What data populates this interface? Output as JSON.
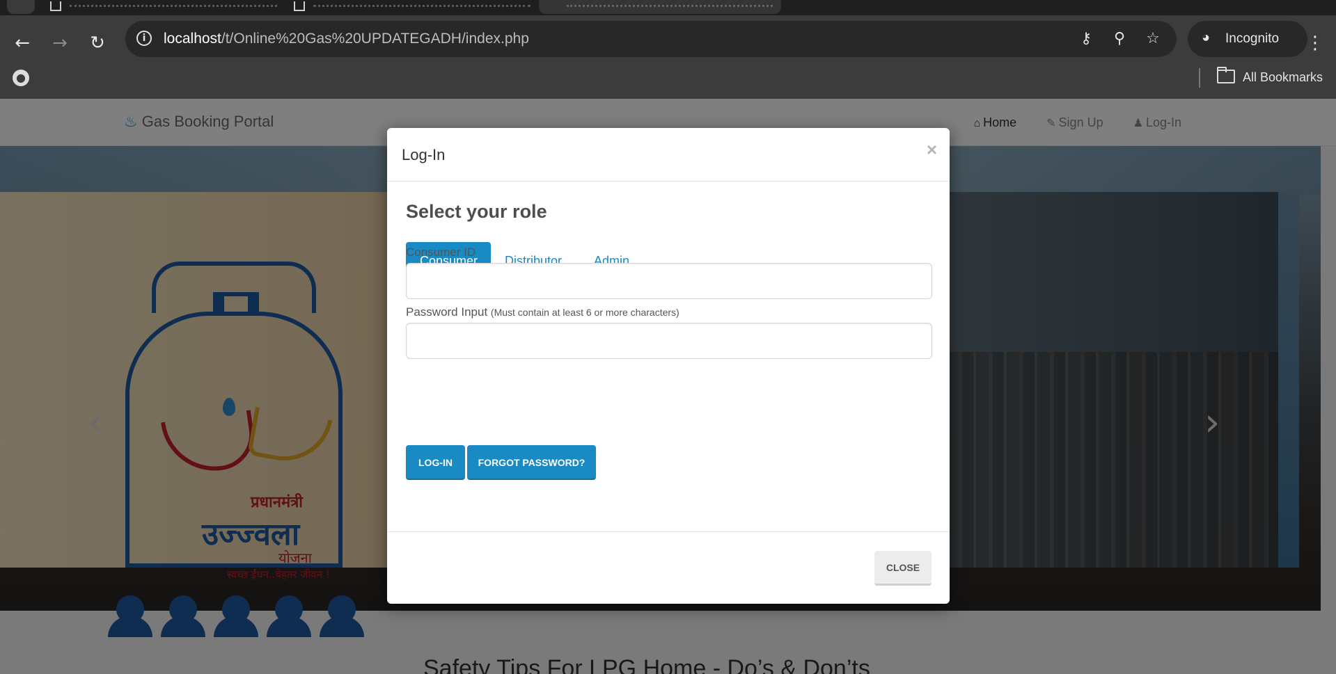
{
  "browser": {
    "url_host": "localhost",
    "url_path": "/t/Online%20Gas%20UPDATEGADH/index.php",
    "incognito_label": "Incognito",
    "bookmarks_label": "All Bookmarks"
  },
  "navbar": {
    "brand": "Gas Booking Portal",
    "links": [
      {
        "label": "Home",
        "icon": "home-icon"
      },
      {
        "label": "Sign Up",
        "icon": "pencil-icon"
      },
      {
        "label": "Log-In",
        "icon": "user-icon"
      }
    ]
  },
  "hero": {
    "logo_line1": "प्रधानमंत्री",
    "logo_line2": "उज्ज्वला",
    "logo_line3": "योजना",
    "logo_line4": "स्वच्छ ईंधन..बेहतर जीवन !"
  },
  "section": {
    "title": "Safety Tips For LPG Home - Do’s & Don’ts"
  },
  "modal": {
    "title": "Log-In",
    "close_symbol": "×",
    "role_heading": "Select your role",
    "roles": [
      "Consumer",
      "Distributor",
      "Admin"
    ],
    "active_role": "Consumer",
    "consumer_id_label": "Consumer ID",
    "consumer_id_value": "",
    "password_label": "Password Input",
    "password_hint": "(Must contain at least 6 or more characters)",
    "password_value": "",
    "login_button": "LOG-IN",
    "forgot_button": "FORGOT PASSWORD?",
    "close_button": "CLOSE"
  },
  "colors": {
    "accent": "#1a8ac4",
    "chrome_bg": "#3c3c3c",
    "omnibox_bg": "#282828"
  }
}
